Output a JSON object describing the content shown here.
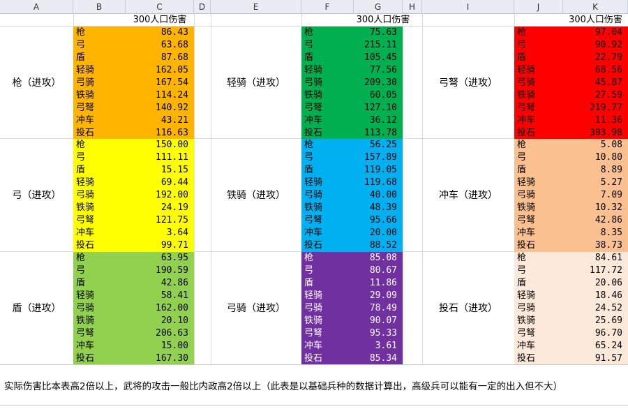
{
  "columns": [
    "A",
    "B",
    "C",
    "D",
    "E",
    "F",
    "G",
    "H",
    "I",
    "J",
    "K"
  ],
  "header_label": "300人口伤害",
  "footnote": "实际伤害比本表高2倍以上，武将的攻击一般比内政高2倍以上（此表是以基础兵种的数据计算出，高级兵可以能有一定的出入但不大）",
  "colors": {
    "qiang": "#ffb400",
    "gong": "#ffff00",
    "dun": "#92d050",
    "qingqi": "#00b050",
    "tieqi": "#00b0f0",
    "gongqi": "#7030a0",
    "gongnu": "#ff0000",
    "chongche": "#fac090",
    "toushi": "#fde9d9"
  },
  "blocks": [
    {
      "attacker": "枪（进攻）",
      "color_key": "qiang",
      "rows": [
        {
          "name": "枪",
          "value": "86.43"
        },
        {
          "name": "弓",
          "value": "63.68"
        },
        {
          "name": "盾",
          "value": "87.68"
        },
        {
          "name": "轻骑",
          "value": "162.05"
        },
        {
          "name": "弓骑",
          "value": "167.54"
        },
        {
          "name": "铁骑",
          "value": "114.24"
        },
        {
          "name": "弓弩",
          "value": "140.92"
        },
        {
          "name": "冲车",
          "value": "43.21"
        },
        {
          "name": "投石",
          "value": "116.63"
        }
      ]
    },
    {
      "attacker": "弓（进攻）",
      "color_key": "gong",
      "rows": [
        {
          "name": "枪",
          "value": "150.00"
        },
        {
          "name": "弓",
          "value": "111.11"
        },
        {
          "name": "盾",
          "value": "15.15"
        },
        {
          "name": "轻骑",
          "value": "69.44"
        },
        {
          "name": "弓骑",
          "value": "192.00"
        },
        {
          "name": "铁骑",
          "value": "24.19"
        },
        {
          "name": "弓弩",
          "value": "121.75"
        },
        {
          "name": "冲车",
          "value": "3.64"
        },
        {
          "name": "投石",
          "value": "99.71"
        }
      ]
    },
    {
      "attacker": "盾（进攻）",
      "color_key": "dun",
      "rows": [
        {
          "name": "枪",
          "value": "63.95"
        },
        {
          "name": "弓",
          "value": "190.59"
        },
        {
          "name": "盾",
          "value": "42.86"
        },
        {
          "name": "轻骑",
          "value": "58.41"
        },
        {
          "name": "弓骑",
          "value": "162.00"
        },
        {
          "name": "铁骑",
          "value": "20.10"
        },
        {
          "name": "弓弩",
          "value": "206.63"
        },
        {
          "name": "冲车",
          "value": "15.00"
        },
        {
          "name": "投石",
          "value": "167.30"
        }
      ]
    },
    {
      "attacker": "轻骑（进攻）",
      "color_key": "qingqi",
      "rows": [
        {
          "name": "枪",
          "value": "75.63"
        },
        {
          "name": "弓",
          "value": "215.11"
        },
        {
          "name": "盾",
          "value": "105.45"
        },
        {
          "name": "轻骑",
          "value": "77.56"
        },
        {
          "name": "弓骑",
          "value": "209.30"
        },
        {
          "name": "铁骑",
          "value": "60.05"
        },
        {
          "name": "弓弩",
          "value": "127.10"
        },
        {
          "name": "冲车",
          "value": "36.12"
        },
        {
          "name": "投石",
          "value": "113.78"
        }
      ]
    },
    {
      "attacker": "铁骑（进攻）",
      "color_key": "tieqi",
      "rows": [
        {
          "name": "枪",
          "value": "56.25"
        },
        {
          "name": "弓",
          "value": "157.89"
        },
        {
          "name": "盾",
          "value": "119.05"
        },
        {
          "name": "轻骑",
          "value": "119.68"
        },
        {
          "name": "弓骑",
          "value": "40.00"
        },
        {
          "name": "铁骑",
          "value": "48.39"
        },
        {
          "name": "弓弩",
          "value": "95.66"
        },
        {
          "name": "冲车",
          "value": "20.00"
        },
        {
          "name": "投石",
          "value": "88.52"
        }
      ]
    },
    {
      "attacker": "弓骑（进攻）",
      "color_key": "gongqi",
      "rows": [
        {
          "name": "枪",
          "value": "85.08"
        },
        {
          "name": "弓",
          "value": "80.67"
        },
        {
          "name": "盾",
          "value": "11.86"
        },
        {
          "name": "轻骑",
          "value": "29.09"
        },
        {
          "name": "弓骑",
          "value": "78.49"
        },
        {
          "name": "铁骑",
          "value": "90.07"
        },
        {
          "name": "弓弩",
          "value": "95.33"
        },
        {
          "name": "冲车",
          "value": "3.61"
        },
        {
          "name": "投石",
          "value": "85.34"
        }
      ]
    },
    {
      "attacker": "弓弩（进攻）",
      "color_key": "gongnu",
      "rows": [
        {
          "name": "枪",
          "value": "97.04"
        },
        {
          "name": "弓",
          "value": "90.92"
        },
        {
          "name": "盾",
          "value": "22.79"
        },
        {
          "name": "轻骑",
          "value": "68.56"
        },
        {
          "name": "弓骑",
          "value": "45.87"
        },
        {
          "name": "铁骑",
          "value": "27.59"
        },
        {
          "name": "弓弩",
          "value": "219.77"
        },
        {
          "name": "冲车",
          "value": "11.36"
        },
        {
          "name": "投石",
          "value": "303.98"
        }
      ]
    },
    {
      "attacker": "冲车（进攻）",
      "color_key": "chongche",
      "rows": [
        {
          "name": "枪",
          "value": "5.08"
        },
        {
          "name": "弓",
          "value": "10.80"
        },
        {
          "name": "盾",
          "value": "8.89"
        },
        {
          "name": "轻骑",
          "value": "5.27"
        },
        {
          "name": "弓骑",
          "value": "7.09"
        },
        {
          "name": "铁骑",
          "value": "10.32"
        },
        {
          "name": "弓弩",
          "value": "42.86"
        },
        {
          "name": "冲车",
          "value": "8.35"
        },
        {
          "name": "投石",
          "value": "38.73"
        }
      ]
    },
    {
      "attacker": "投石（进攻）",
      "color_key": "toushi",
      "rows": [
        {
          "name": "枪",
          "value": "84.61"
        },
        {
          "name": "弓",
          "value": "117.72"
        },
        {
          "name": "盾",
          "value": "20.06"
        },
        {
          "name": "轻骑",
          "value": "18.46"
        },
        {
          "name": "弓骑",
          "value": "24.52"
        },
        {
          "name": "铁骑",
          "value": "25.69"
        },
        {
          "name": "弓弩",
          "value": "96.70"
        },
        {
          "name": "冲车",
          "value": "65.24"
        },
        {
          "name": "投石",
          "value": "91.57"
        }
      ]
    }
  ]
}
